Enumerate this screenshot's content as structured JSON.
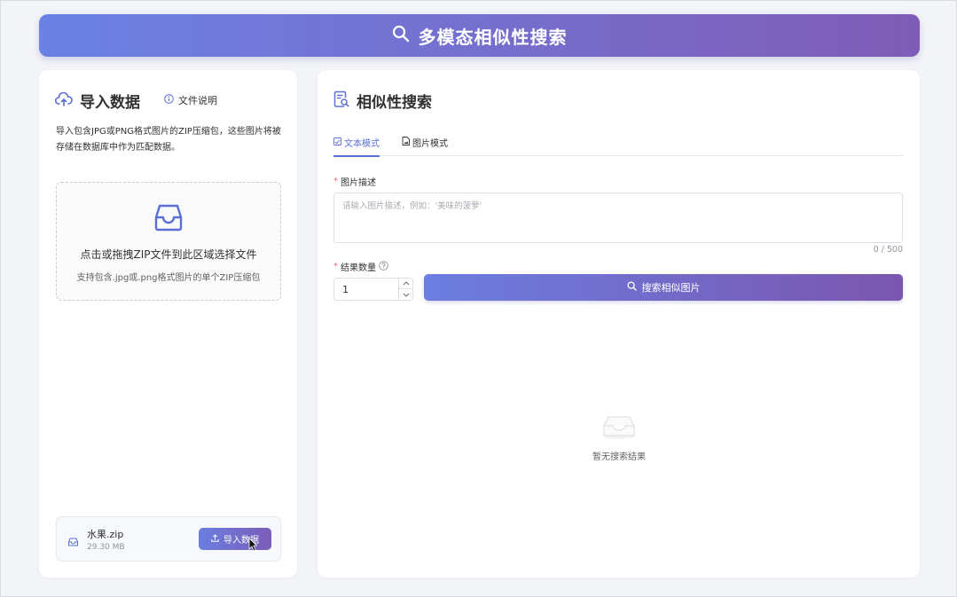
{
  "header": {
    "title": "多模态相似性搜索"
  },
  "import": {
    "title": "导入数据",
    "help_label": "文件说明",
    "description": "导入包含JPG或PNG格式图片的ZIP压缩包，这些图片将被存储在数据库中作为匹配数据。",
    "dropzone_main": "点击或拖拽ZIP文件到此区域选择文件",
    "dropzone_sub": "支持包含.jpg或.png格式图片的单个ZIP压缩包",
    "file": {
      "name": "水果.zip",
      "size": "29.30 MB"
    },
    "import_button": "导入数据"
  },
  "search": {
    "title": "相似性搜索",
    "tabs": [
      {
        "label": "文本模式",
        "active": true
      },
      {
        "label": "图片模式",
        "active": false
      }
    ],
    "desc_label": "图片描述",
    "desc_placeholder": "请输入图片描述，例如：'美味的菠萝'",
    "desc_counter": "0 / 500",
    "count_label": "结果数量",
    "count_value": "1",
    "search_button": "搜索相似图片",
    "empty_text": "暂无搜索结果"
  },
  "colors": {
    "accent": "#5b6fd6",
    "gradient_start": "#6b82e4",
    "gradient_end": "#7f5cb7",
    "required": "#f56c6c"
  },
  "icons": [
    "search-icon",
    "cloud-upload-icon",
    "info-icon",
    "inbox-icon",
    "search-document-icon",
    "text-mode-icon",
    "image-mode-icon",
    "help-circle-icon",
    "upload-icon",
    "cursor-icon"
  ]
}
